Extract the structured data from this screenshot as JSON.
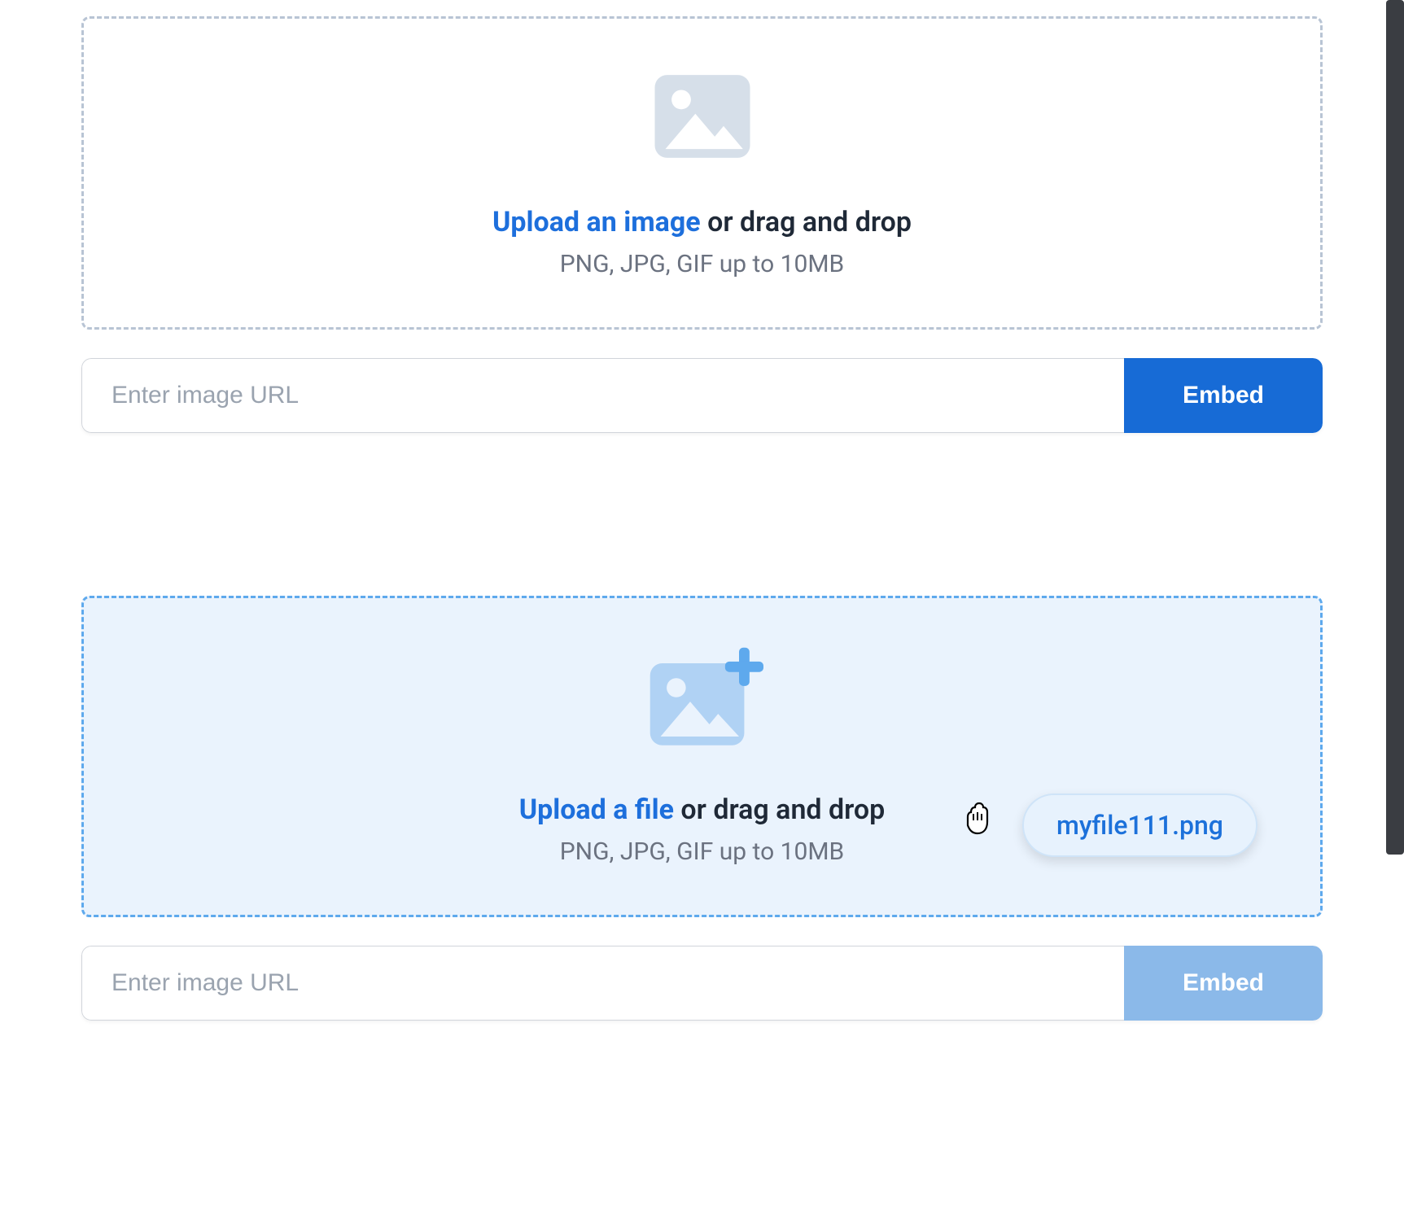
{
  "dropzone1": {
    "uploadLink": "Upload an image",
    "dragText": " or drag and drop",
    "hint": "PNG, JPG, GIF up to 10MB"
  },
  "urlRow1": {
    "placeholder": "Enter image URL",
    "embed": "Embed"
  },
  "dropzone2": {
    "uploadLink": "Upload a file",
    "dragText": " or drag and drop",
    "hint": "PNG, JPG, GIF up to 10MB"
  },
  "urlRow2": {
    "placeholder": "Enter image URL",
    "embed": "Embed"
  },
  "drag": {
    "filename": "myfile111.png"
  }
}
